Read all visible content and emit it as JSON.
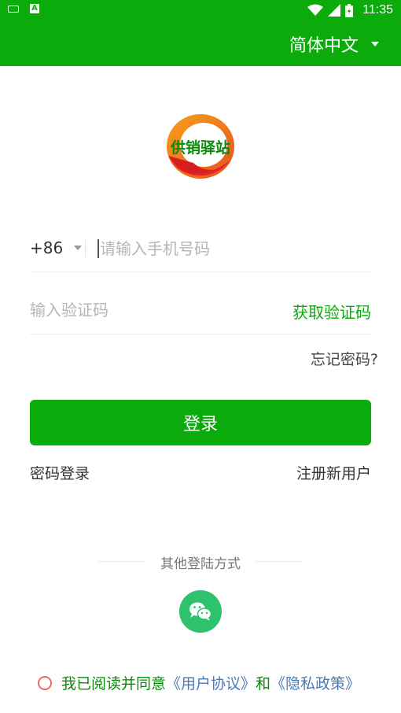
{
  "status_bar": {
    "time": "11:35",
    "icons": [
      "keyboard-icon",
      "a-notification-icon",
      "wifi-icon",
      "signal-icon",
      "battery-icon"
    ]
  },
  "app_bar": {
    "language": "简体中文"
  },
  "logo": {
    "text": "供销驿站"
  },
  "phone": {
    "country_code": "+86",
    "placeholder": "请输入手机号码"
  },
  "code": {
    "placeholder": "输入验证码",
    "get_code_label": "获取验证码"
  },
  "forgot_label": "忘记密码?",
  "login_label": "登录",
  "password_login_label": "密码登录",
  "register_label": "注册新用户",
  "other_login_label": "其他登陆方式",
  "agreement": {
    "prefix": "我已阅读并同意",
    "user_agreement": "《用户协议》",
    "conjunction": "和",
    "privacy_policy": "《隐私政策》"
  },
  "colors": {
    "brand": "#0aab0a",
    "wechat": "#2dc26b",
    "link": "#4a79b8"
  }
}
